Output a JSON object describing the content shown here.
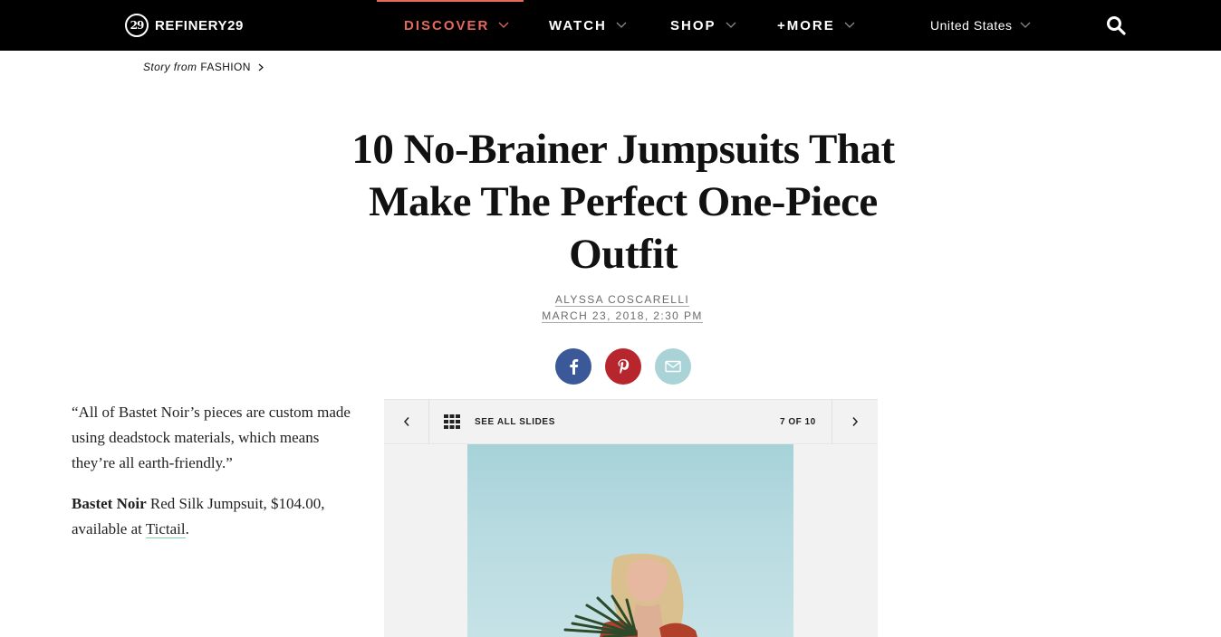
{
  "nav": {
    "logo_text": "REFINERY29",
    "logo_mark": "29",
    "items": [
      {
        "label": "DISCOVER",
        "active": true
      },
      {
        "label": "WATCH",
        "active": false
      },
      {
        "label": "SHOP",
        "active": false
      },
      {
        "label": "+MORE",
        "active": false
      }
    ],
    "country": "United States",
    "search_icon": "search-icon"
  },
  "breadcrumb": {
    "prefix": "Story from",
    "section": "FASHION"
  },
  "article": {
    "title": "10 No-Brainer Jumpsuits That Make The Perfect One-Piece Outfit",
    "author": "ALYSSA COSCARELLI",
    "date": "MARCH 23, 2018, 2:30 PM"
  },
  "share": {
    "facebook_icon": "facebook-icon",
    "pinterest_icon": "pinterest-icon",
    "email_icon": "email-icon"
  },
  "slide": {
    "quote": "“All of Bastet Noir’s pieces are custom made using deadstock materials, which means they’re all earth-friendly.”",
    "brand": "Bastet Noir",
    "product_text": " Red Silk Jumpsuit, $104.00, available at ",
    "link_text": "Tictail",
    "end_punct": ".",
    "see_all_label": "SEE ALL SLIDES",
    "counter": "7 OF 10"
  },
  "colors": {
    "nav_bg": "#000000",
    "accent": "#e5685e",
    "facebook": "#3b5998",
    "pinterest": "#b7262c",
    "email": "#a9d3d6"
  }
}
